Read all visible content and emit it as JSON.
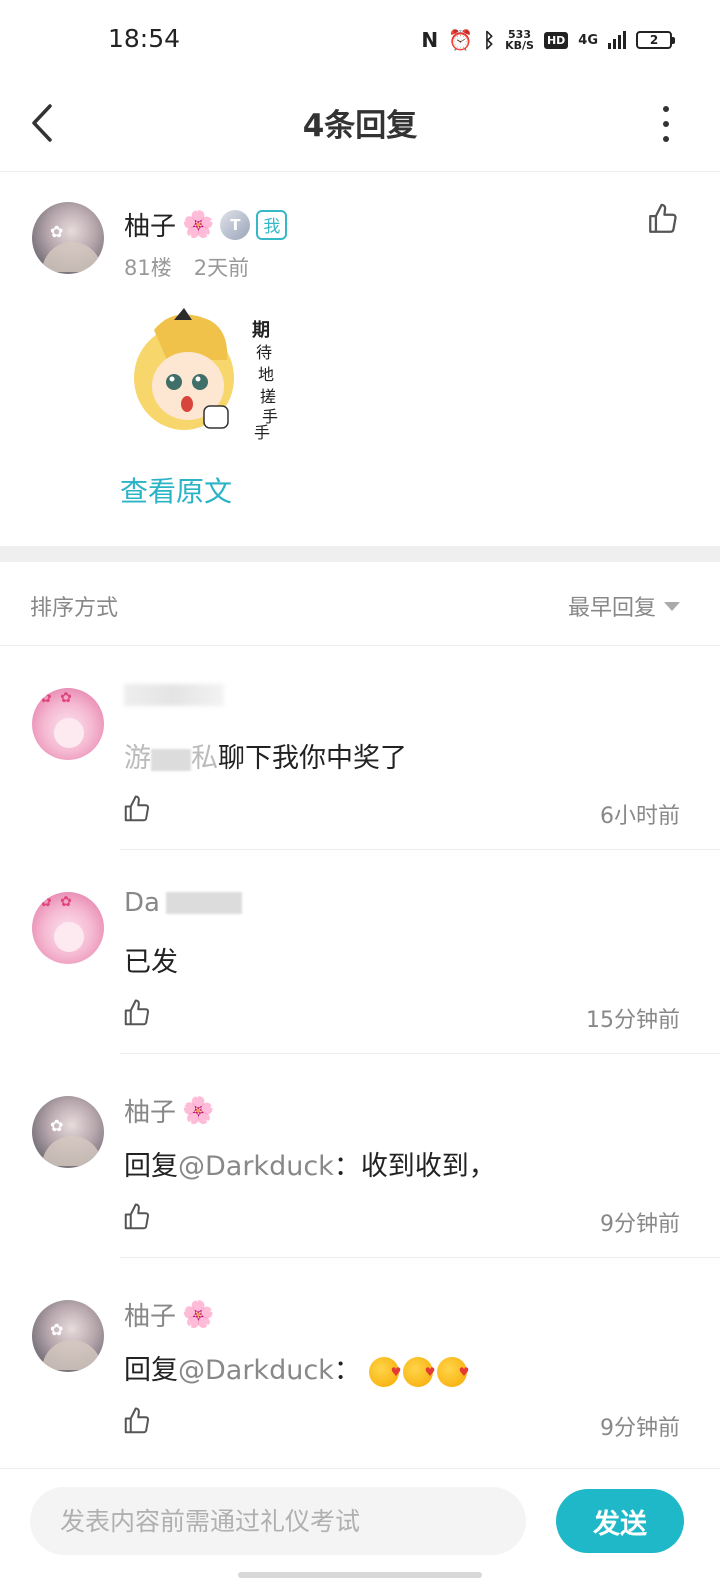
{
  "status_bar": {
    "time": "18:54",
    "speed_value": "533",
    "speed_unit": "KB/S",
    "hd_label": "HD",
    "network": "4G",
    "battery": "2"
  },
  "header": {
    "title": "4条回复",
    "back_icon": "chevron-left-icon",
    "more_icon": "more-vertical-icon"
  },
  "main_post": {
    "username": "柚子",
    "level_badge": "T",
    "me_badge": "我",
    "floor": "81楼",
    "time": "2天前",
    "sticker_text": "期待地搓手手",
    "view_original": "查看原文"
  },
  "sort": {
    "label": "排序方式",
    "value": "最早回复"
  },
  "replies": [
    {
      "username": "",
      "text_visible": "聊下我你中奖了",
      "text_prefix": "游",
      "text_mid": "私",
      "time": "6小时前"
    },
    {
      "username": "Da",
      "text": "已发",
      "time": "15分钟前"
    },
    {
      "username": "柚子",
      "reply_prefix": "回复",
      "mention": "@Darkduck",
      "separator": "：",
      "text": "收到收到，",
      "time": "9分钟前"
    },
    {
      "username": "柚子",
      "reply_prefix": "回复",
      "mention": "@Darkduck",
      "separator": "：",
      "emoji_count": 3,
      "time": "9分钟前"
    }
  ],
  "input_bar": {
    "placeholder": "发表内容前需通过礼仪考试",
    "send_label": "发送"
  },
  "colors": {
    "accent": "#1fb8c9",
    "link": "#2bb3c6",
    "sakura": "#f47fa8"
  }
}
